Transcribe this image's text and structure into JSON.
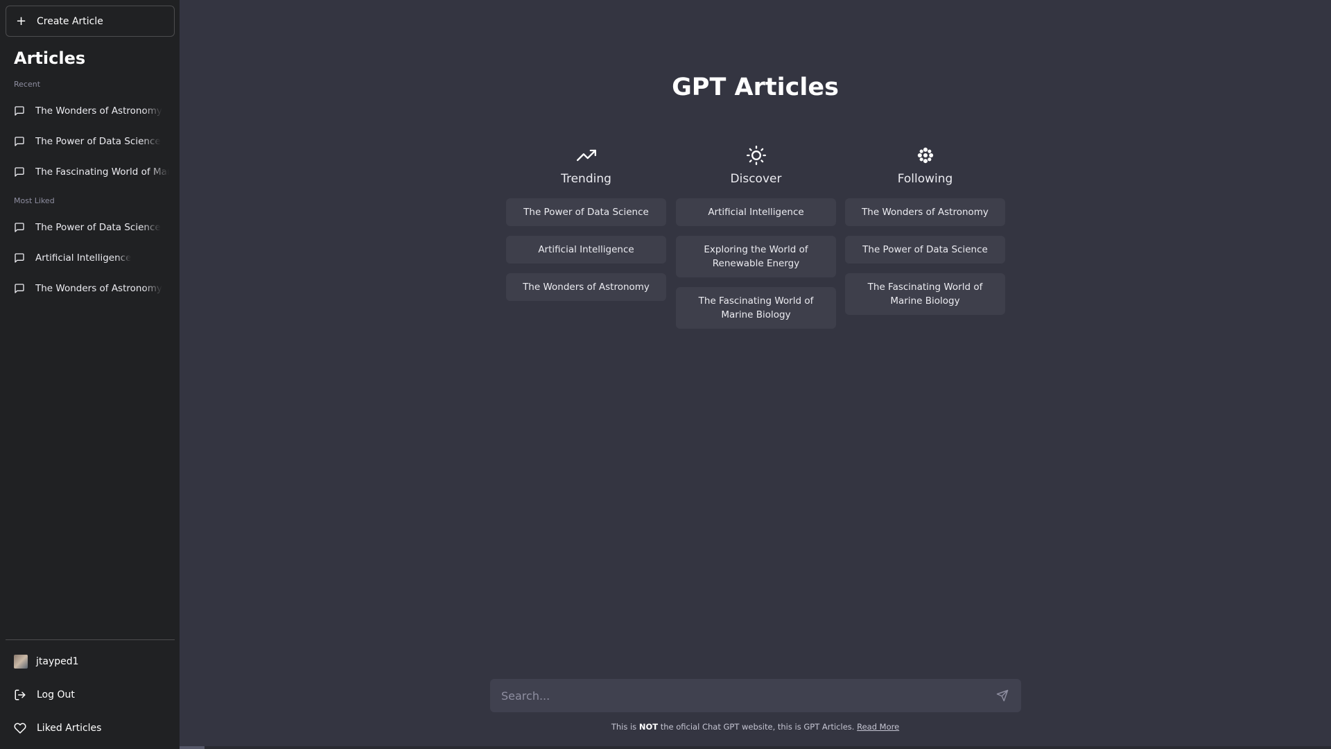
{
  "sidebar": {
    "create_label": "Create Article",
    "title": "Articles",
    "recent_label": "Recent",
    "recent": [
      {
        "label": "The Wonders of Astronomy"
      },
      {
        "label": "The Power of Data Science"
      },
      {
        "label": "The Fascinating World of Marine Biology"
      }
    ],
    "most_liked_label": "Most Liked",
    "most_liked": [
      {
        "label": "The Power of Data Science"
      },
      {
        "label": "Artificial Intelligence"
      },
      {
        "label": "The Wonders of Astronomy"
      }
    ],
    "username": "jtayped1",
    "logout_label": "Log Out",
    "liked_label": "Liked Articles"
  },
  "main": {
    "title": "GPT Articles",
    "columns": [
      {
        "heading": "Trending",
        "icon": "trending-up-icon",
        "items": [
          "The Power of Data Science",
          "Artificial Intelligence",
          "The Wonders of Astronomy"
        ]
      },
      {
        "heading": "Discover",
        "icon": "sun-icon",
        "items": [
          "Artificial Intelligence",
          "Exploring the World of Renewable Energy",
          "The Fascinating World of Marine Biology"
        ]
      },
      {
        "heading": "Following",
        "icon": "flower-icon",
        "items": [
          "The Wonders of Astronomy",
          "The Power of Data Science",
          "The Fascinating World of Marine Biology"
        ]
      }
    ]
  },
  "search": {
    "placeholder": "Search..."
  },
  "footer": {
    "prefix": "This is ",
    "emphasis": "NOT",
    "suffix": " the oficial Chat GPT website, this is GPT Articles. ",
    "link": "Read More"
  },
  "colors": {
    "sidebar_bg": "#202123",
    "main_bg": "#343541",
    "card_bg": "#3e3f4b",
    "input_bg": "#40414f"
  }
}
